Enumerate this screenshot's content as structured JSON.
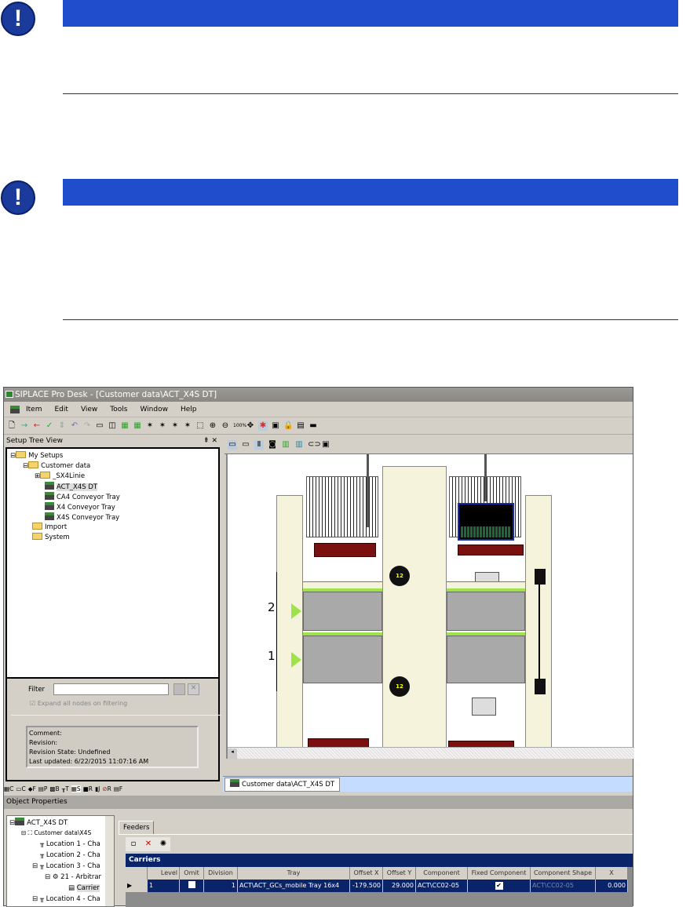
{
  "notices": [
    {
      "icon": "exclamation-icon"
    },
    {
      "icon": "exclamation-icon"
    }
  ],
  "colors": {
    "notice_bar": "#1f4dcc",
    "selection": "#0a246a",
    "tab_bar": "#c3dcff"
  },
  "app": {
    "title": "SIPLACE Pro Desk - [Customer data\\ACT_X4S DT]",
    "menu": [
      "Item",
      "Edit",
      "View",
      "Tools",
      "Window",
      "Help"
    ],
    "setup_tree": {
      "header": "Setup Tree View",
      "pin": "⇞ ✕",
      "nodes": [
        "My Setups",
        "Customer data",
        "_SX4Linie",
        "ACT_X4S DT",
        "CA4 Conveyor Tray",
        "X4 Conveyor Tray",
        "X4S Conveyor Tray",
        "Import",
        "System"
      ]
    },
    "filter": {
      "label": "Filter",
      "value": "",
      "expand_label": "Expand all nodes on filtering"
    },
    "info": {
      "comment": "Comment:",
      "revision": "Revision:",
      "revision_state": "Revision State: Undefined",
      "last_updated": "Last updated: 6/22/2015 11:07:16 AM"
    },
    "bottom_tabs": [
      "C",
      "C",
      "F",
      "P",
      "B",
      "T",
      "S",
      "R",
      "J",
      "R",
      "F"
    ],
    "canvas": {
      "arrow_labels": [
        "2",
        "1"
      ],
      "nozzle_label": "12"
    },
    "doc_tab": "Customer data\\ACT_X4S DT",
    "object_properties": {
      "header": "Object Properties",
      "tree": [
        "ACT_X4S DT",
        "Customer data\\X4S",
        "Location 1 - Cha",
        "Location 2 - Cha",
        "Location 3 - Cha",
        "21 - Arbitrar",
        "Carrier",
        "Location 4 - Cha"
      ],
      "tab": "Feeders",
      "grid_title": "Carriers",
      "columns": [
        "Level",
        "Omit",
        "Division",
        "Tray",
        "Offset X",
        "Offset Y",
        "Component",
        "Fixed Component",
        "Component Shape",
        "X"
      ],
      "row": {
        "level": "1",
        "omit": false,
        "division": "1",
        "tray": "ACT\\ACT_GCs_mobile Tray 16x4",
        "offset_x": "-179.500",
        "offset_y": "29.000",
        "component": "ACT\\CC02-05",
        "fixed_component": true,
        "component_shape": "ACT\\CC02-05",
        "x": "0.000"
      }
    }
  }
}
